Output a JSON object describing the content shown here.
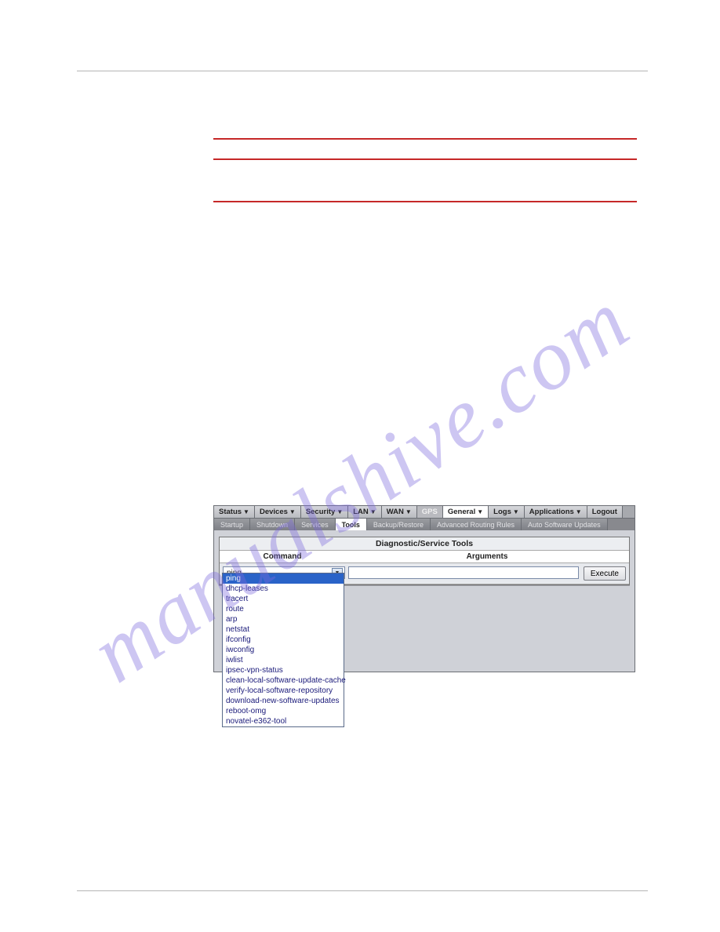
{
  "watermark_text": "manualshive.com",
  "nav_tabs": [
    {
      "label": "Status"
    },
    {
      "label": "Devices"
    },
    {
      "label": "Security"
    },
    {
      "label": "LAN"
    },
    {
      "label": "WAN"
    },
    {
      "label": "GPS"
    },
    {
      "label": "General"
    },
    {
      "label": "Logs"
    },
    {
      "label": "Applications"
    },
    {
      "label": "Logout"
    }
  ],
  "sub_tabs": [
    {
      "label": "Startup"
    },
    {
      "label": "Shutdown"
    },
    {
      "label": "Services"
    },
    {
      "label": "Tools"
    },
    {
      "label": "Backup/Restore"
    },
    {
      "label": "Advanced Routing Rules"
    },
    {
      "label": "Auto Software Updates"
    }
  ],
  "panel": {
    "title": "Diagnostic/Service Tools",
    "col_command": "Command",
    "col_arguments": "Arguments",
    "selected_command": "ping",
    "execute_label": "Execute"
  },
  "command_options": [
    "ping",
    "dhcp-leases",
    "tracert",
    "route",
    "arp",
    "netstat",
    "ifconfig",
    "iwconfig",
    "iwlist",
    "ipsec-vpn-status",
    "clean-local-software-update-cache",
    "verify-local-software-repository",
    "download-new-software-updates",
    "reboot-omg",
    "novatel-e362-tool"
  ]
}
